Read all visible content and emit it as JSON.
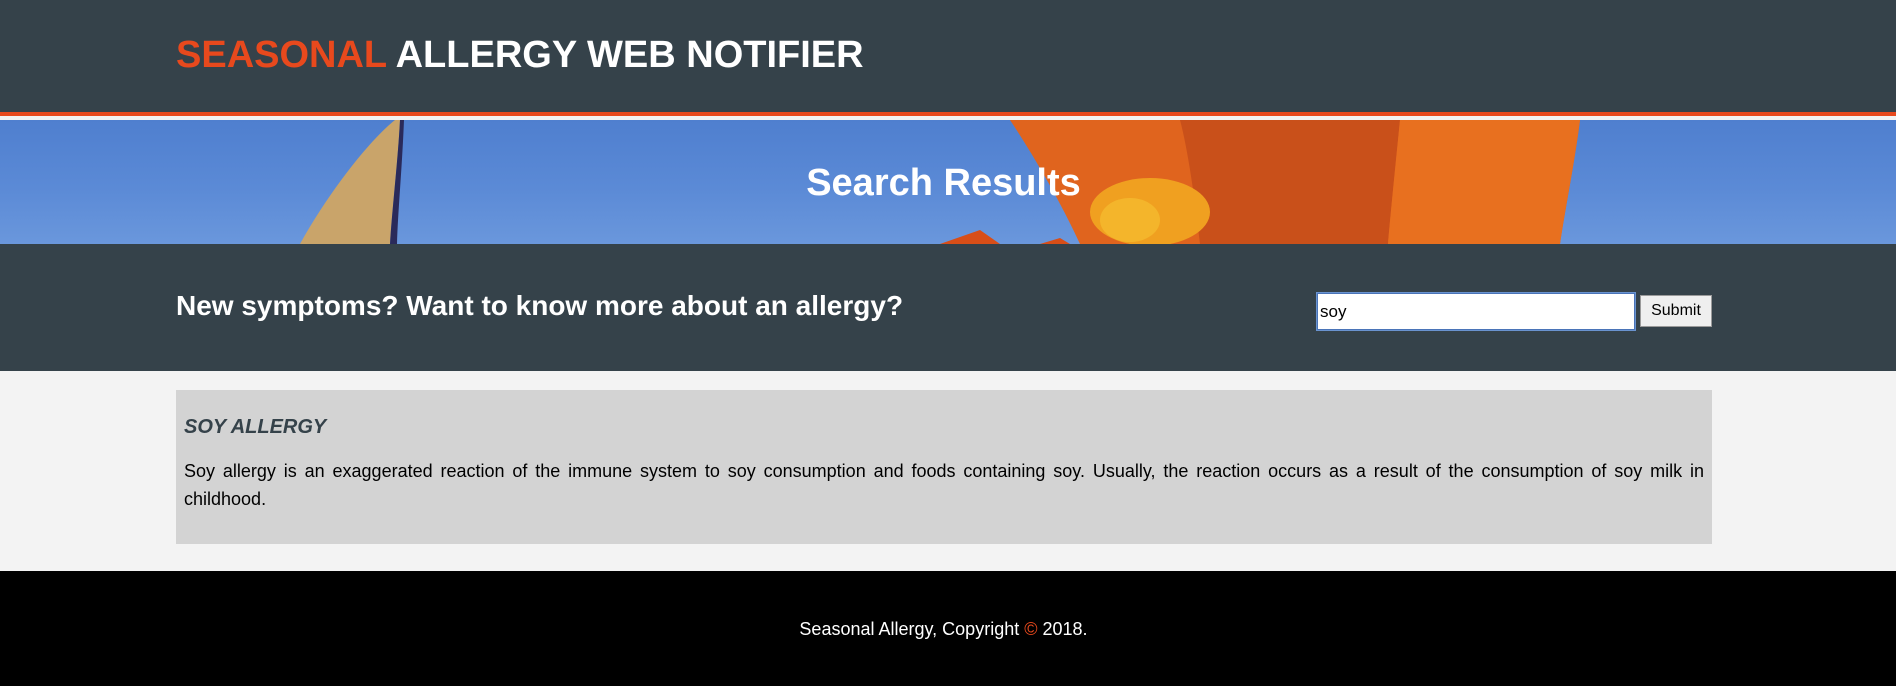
{
  "header": {
    "brand_highlight": "SEASONAL",
    "brand_rest": "ALLERGY WEB NOTIFIER"
  },
  "hero": {
    "title": "Search Results"
  },
  "search": {
    "prompt": "New symptoms? Want to know more about an allergy?",
    "value": "soy",
    "submit_label": "Submit"
  },
  "results": [
    {
      "title": "SOY ALLERGY",
      "body": "Soy allergy is an exaggerated reaction of the immune system to soy consumption and foods containing soy. Usually, the reaction occurs as a result of the consumption of soy milk in childhood."
    }
  ],
  "footer": {
    "text_before": "Seasonal Allergy, Copyright",
    "symbol": "©",
    "text_after": "2018."
  },
  "colors": {
    "accent": "#e8491d",
    "dark": "#35424a",
    "card": "#d3d3d3",
    "page_bg": "#f3f3f3",
    "footer_bg": "#000000"
  }
}
